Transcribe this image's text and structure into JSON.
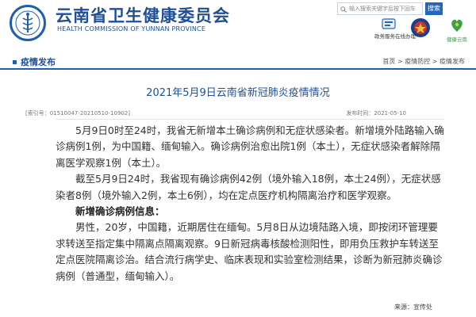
{
  "header": {
    "site_title": "云南省卫生健康委员会",
    "site_subtitle": "HEALTH COMMISSION OF YUNNAN PROVINCE",
    "search": {
      "placeholder": "输入搜索关键字后按下回车",
      "button_label": "搜索"
    },
    "quick_icons": [
      {
        "label": "政务服务在线办理",
        "icon": "service-icon"
      },
      {
        "label": "",
        "icon": "badge-icon"
      },
      {
        "label": "健康云南",
        "icon": "health-yunnan-icon"
      }
    ]
  },
  "nav": {
    "section_title": "疫情发布",
    "breadcrumb": "首页 > 疫情防控 > 疫情发布"
  },
  "article": {
    "title": "2021年5月9日云南省新冠肺炎疫情情况",
    "index_no": "[索引号：01510047-20210510-10902]",
    "date": "发布时间：2021-05-10",
    "paragraphs": [
      "5月9日0时至24时，我省无新增本土确诊病例和无症状感染者。新增境外陆路输入确诊病例1例，为中国籍、缅甸输入。确诊病例治愈出院1例（本土），无症状感染者解除隔离医学观察1例（本土）。",
      "截至5月9日24时，我省现有确诊病例42例（境外输入18例，本土24例），无症状感染者8例（境外输入2例，本土6例），均在定点医疗机构隔离治疗和医学观察。",
      "新增确诊病例信息：",
      "男性，20岁，中国籍，近期居住在缅甸。5月8日从边境陆路入境，即按闭环管理要求转送至指定集中隔离点隔离观察。9日新冠病毒核酸检测阳性，即用负压救护车转送至定点医院隔离诊治。结合流行病学史、临床表现和实验室检测结果，诊断为新冠肺炎确诊病例（普通型，缅甸输入）。"
    ],
    "source": "来源：宣传处"
  },
  "colors": {
    "brand_blue": "#1f4f96",
    "accent_blue": "#2466b8"
  }
}
